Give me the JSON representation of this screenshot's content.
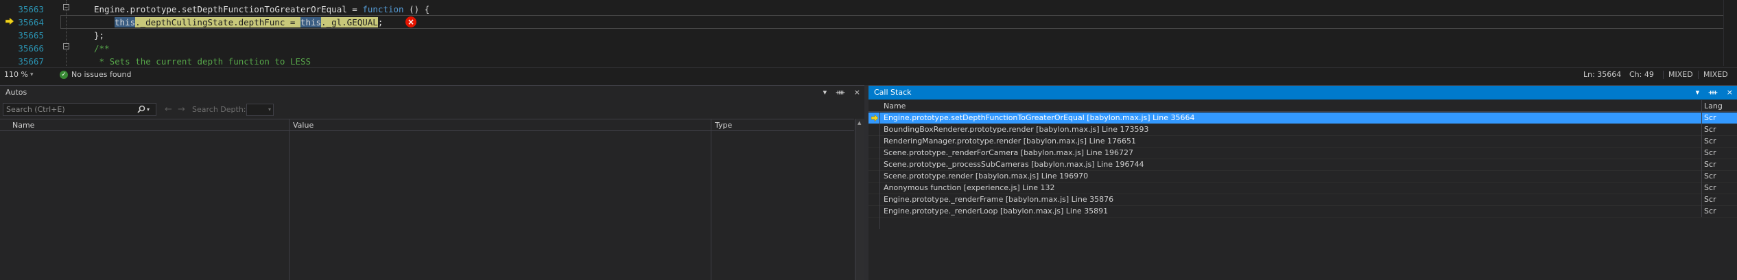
{
  "editor": {
    "lines": [
      {
        "num": "35663",
        "code_parts": [
          {
            "t": "Engine.prototype.setDepthFunctionToGreaterOrEqual = ",
            "c": ""
          },
          {
            "t": "function",
            "c": "kw"
          },
          {
            "t": " () {",
            "c": ""
          }
        ]
      },
      {
        "num": "35664",
        "code_parts": [
          {
            "t": "this",
            "c": "hl"
          },
          {
            "t": "._depthCullingState.depthFunc = ",
            "c": "hly"
          },
          {
            "t": "this",
            "c": "hl"
          },
          {
            "t": "._gl.GEQUAL",
            "c": "hly"
          },
          {
            "t": ";",
            "c": ""
          }
        ]
      },
      {
        "num": "35665",
        "code_parts": [
          {
            "t": "};",
            "c": ""
          }
        ]
      },
      {
        "num": "35666",
        "code_parts": [
          {
            "t": "/**",
            "c": "cm"
          }
        ]
      },
      {
        "num": "35667",
        "code_parts": [
          {
            "t": " * Sets the current depth function to LESS",
            "c": "cm"
          }
        ]
      }
    ],
    "error_glyph": "×",
    "fold_minus": "−"
  },
  "status": {
    "zoom": "110 %",
    "issues": "No issues found",
    "ln": "Ln: 35664",
    "ch": "Ch: 49",
    "mixed1": "MIXED",
    "mixed2": "MIXED"
  },
  "autos": {
    "title": "Autos",
    "search_placeholder": "Search (Ctrl+E)",
    "search_depth_label": "Search Depth:",
    "columns": {
      "name": "Name",
      "value": "Value",
      "type": "Type"
    },
    "buttons": {
      "dropdown": "▾",
      "pin": "ᚓ",
      "close": "×"
    }
  },
  "callstack": {
    "title": "Call Stack",
    "columns": {
      "name": "Name",
      "lang": "Lang"
    },
    "buttons": {
      "dropdown": "▾",
      "pin": "ᚓ",
      "close": "×"
    },
    "frames": [
      {
        "name": "Engine.prototype.setDepthFunctionToGreaterOrEqual [babylon.max.js] Line 35664",
        "lang": "Scr",
        "selected": true
      },
      {
        "name": "BoundingBoxRenderer.prototype.render [babylon.max.js] Line 173593",
        "lang": "Scr",
        "selected": false
      },
      {
        "name": "RenderingManager.prototype.render [babylon.max.js] Line 176651",
        "lang": "Scr",
        "selected": false
      },
      {
        "name": "Scene.prototype._renderForCamera [babylon.max.js] Line 196727",
        "lang": "Scr",
        "selected": false
      },
      {
        "name": "Scene.prototype._processSubCameras [babylon.max.js] Line 196744",
        "lang": "Scr",
        "selected": false
      },
      {
        "name": "Scene.prototype.render [babylon.max.js] Line 196970",
        "lang": "Scr",
        "selected": false
      },
      {
        "name": "Anonymous function [experience.js] Line 132",
        "lang": "Scr",
        "selected": false
      },
      {
        "name": "Engine.prototype._renderFrame [babylon.max.js] Line 35876",
        "lang": "Scr",
        "selected": false
      },
      {
        "name": "Engine.prototype._renderLoop [babylon.max.js] Line 35891",
        "lang": "Scr",
        "selected": false
      }
    ]
  },
  "colors": {
    "accent": "#007acc",
    "selection": "#3399ff",
    "line_number": "#2b91af",
    "keyword": "#569cd6",
    "comment": "#57a64a",
    "error": "#e51400"
  }
}
